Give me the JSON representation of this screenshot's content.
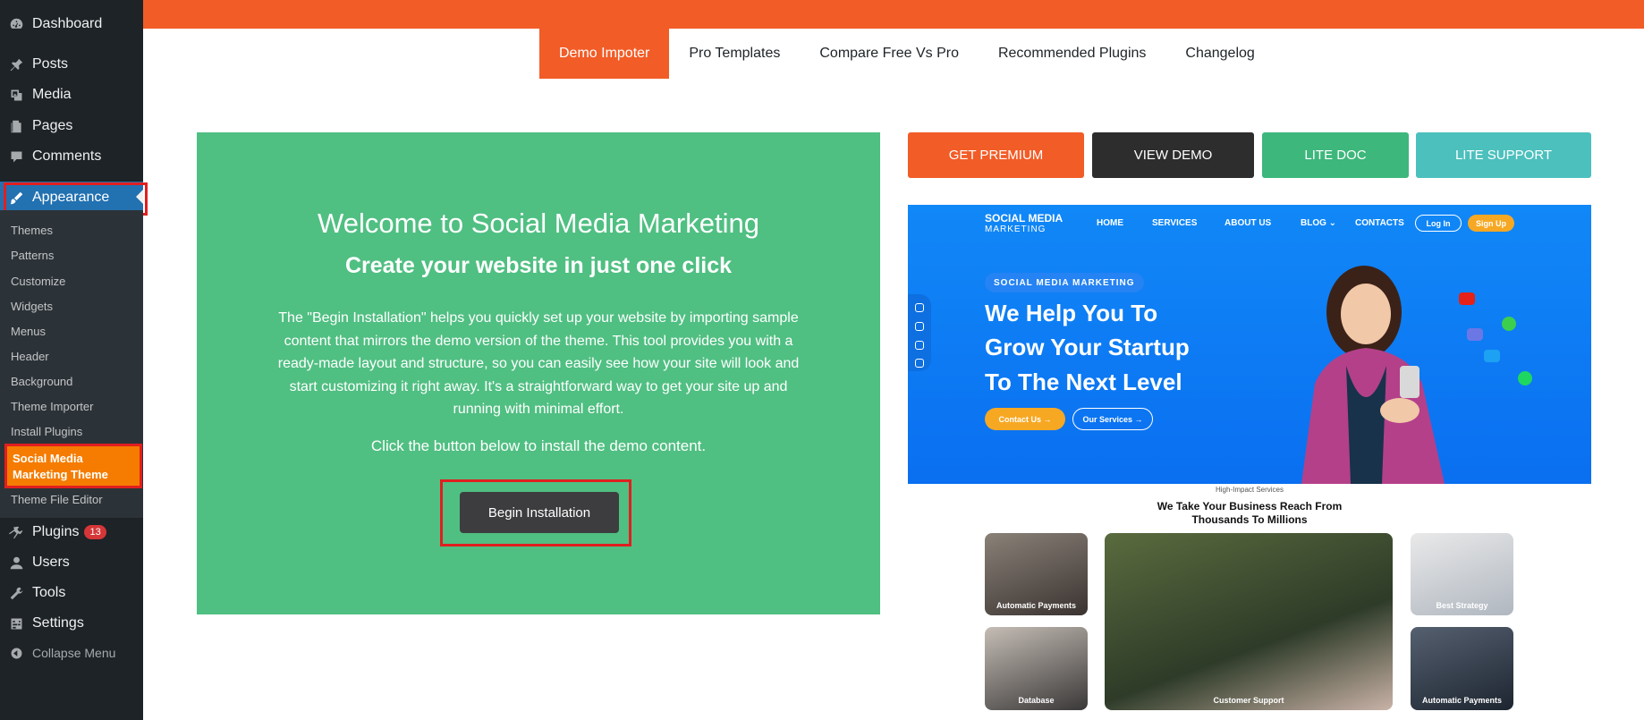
{
  "sidebar": {
    "items": {
      "dashboard": "Dashboard",
      "posts": "Posts",
      "media": "Media",
      "pages": "Pages",
      "comments": "Comments",
      "appearance": "Appearance",
      "plugins": "Plugins",
      "plugins_badge": "13",
      "users": "Users",
      "tools": "Tools",
      "settings": "Settings",
      "collapse": "Collapse Menu"
    },
    "submenu": [
      "Themes",
      "Patterns",
      "Customize",
      "Widgets",
      "Menus",
      "Header",
      "Background",
      "Theme Importer",
      "Install Plugins"
    ],
    "submenu_current": "Social Media Marketing Theme",
    "submenu_last": "Theme File Editor"
  },
  "tabs": [
    "Demo Impoter",
    "Pro Templates",
    "Compare Free Vs Pro",
    "Recommended Plugins",
    "Changelog"
  ],
  "welcome": {
    "title": "Welcome to Social Media Marketing",
    "subtitle": "Create your website in just one click",
    "description": "The \"Begin Installation\" helps you quickly set up your website by importing sample content that mirrors the demo version of the theme. This tool provides you with a ready-made layout and structure, so you can easily see how your site will look and start customizing it right away. It's a straightforward way to get your site up and running with minimal effort.",
    "instruction": "Click the button below to install the demo content.",
    "button": "Begin Installation"
  },
  "actions": {
    "premium": "GET PREMIUM",
    "demo": "VIEW DEMO",
    "doc": "LITE DOC",
    "support": "LITE SUPPORT"
  },
  "preview": {
    "logo_line1": "SOCIAL MEDIA",
    "logo_line2": "MARKETING",
    "nav": [
      "HOME",
      "SERVICES",
      "ABOUT US",
      "BLOG ⌄",
      "CONTACTS"
    ],
    "login": "Log In",
    "signup": "Sign Up",
    "kicker": "SOCIAL MEDIA MARKETING",
    "headline": [
      "We Help You To",
      "Grow Your Startup",
      "To The Next Level"
    ],
    "cta_contact": "Contact Us →",
    "cta_services": "Our Services →",
    "section_label": "High-Impact Services",
    "section_title_1": "We Take Your Business Reach From",
    "section_title_2": "Thousands To Millions",
    "cards": {
      "payments_1": "Automatic Payments",
      "strategy": "Best Strategy",
      "database": "Database",
      "support": "Customer Support",
      "payments_2": "Automatic Payments"
    }
  },
  "colors": {
    "accent": "#f25c27",
    "welcome_bg": "#50bf82",
    "wp_sidebar": "#1d2327",
    "wp_active": "#2271b1",
    "theme_current": "#f57c00",
    "highlight": "#e11f1f",
    "view_demo": "#2d2d2d",
    "lite_doc": "#3db77b",
    "lite_support": "#4cc0bd"
  },
  "icons": [
    "dashboard-icon",
    "pin-icon",
    "media-icon",
    "pages-icon",
    "comment-icon",
    "paintbrush-icon",
    "plugin-icon",
    "users-icon",
    "wrench-icon",
    "settings-icon",
    "collapse-icon"
  ]
}
